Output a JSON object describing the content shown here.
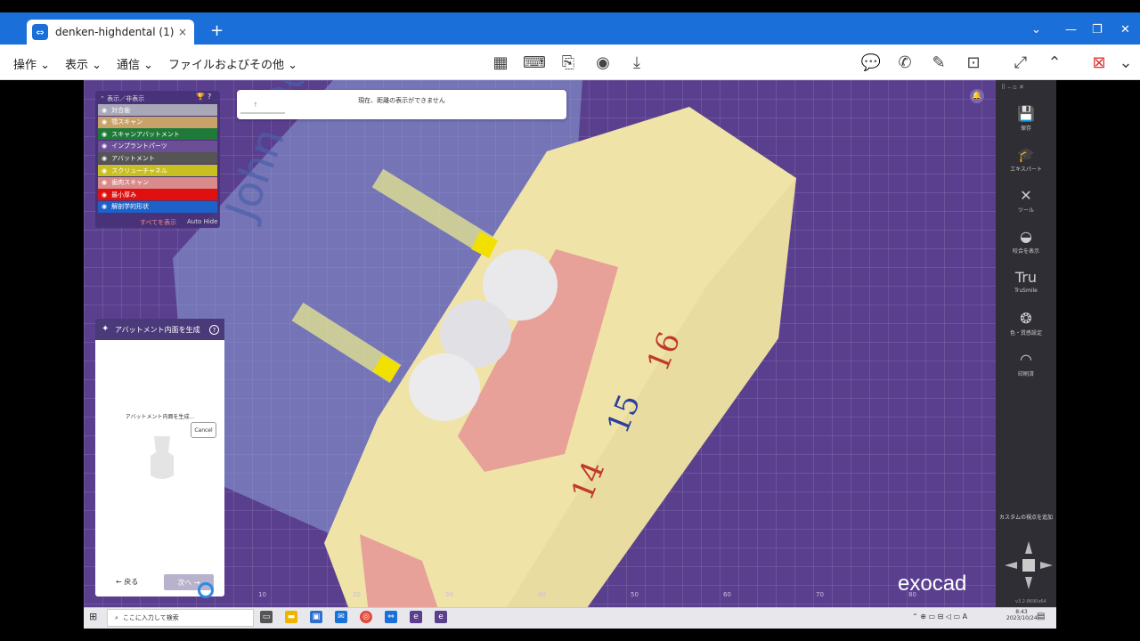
{
  "browser": {
    "tab_title": "denken-highdental (1)",
    "close_glyph": "×",
    "new_tab_glyph": "+"
  },
  "menu": {
    "items": [
      "操作",
      "表示",
      "通信",
      "ファイルおよびその他"
    ]
  },
  "layers": {
    "header": "表示／非表示",
    "items": [
      {
        "label": "対合歯",
        "color": "#a8a8b8"
      },
      {
        "label": "顎スキャン",
        "color": "#c9a26a"
      },
      {
        "label": "スキャンアバットメント",
        "color": "#1f7a3a"
      },
      {
        "label": "インプラントパーツ",
        "color": "#6b4e96"
      },
      {
        "label": "アバットメント",
        "color": "#555555"
      },
      {
        "label": "スクリューチャネル",
        "color": "#c8c020"
      },
      {
        "label": "歯肉スキャン",
        "color": "#d98a8a"
      },
      {
        "label": "最小厚み",
        "color": "#e01010"
      },
      {
        "label": "解剖学的形状",
        "color": "#1d62c8"
      }
    ],
    "show_all": "すべてを表示",
    "auto_hide": "Auto Hide"
  },
  "toast": {
    "message": "現在、距離の表示ができません"
  },
  "wizard": {
    "title": "アバットメント内面を生成",
    "progress_message": "アバットメント内面を生成...",
    "cancel_label": "Cancel",
    "back_label": "戻る",
    "next_label": "次へ"
  },
  "sidebar": {
    "items": [
      {
        "icon": "save-icon",
        "label": "保存"
      },
      {
        "icon": "expert-icon",
        "label": "エキスパート"
      },
      {
        "icon": "tools-icon",
        "label": "ツール"
      },
      {
        "icon": "tooth-icon",
        "label": "咬合を表示"
      },
      {
        "icon": "trusmile-icon",
        "label": "TruSmile"
      },
      {
        "icon": "color-icon",
        "label": "色・質感設定"
      },
      {
        "icon": "crown-icon",
        "label": "印刷済"
      }
    ],
    "custom_view_label": "カスタムの視点を追加",
    "version": "v3.2-8690x64"
  },
  "viewport": {
    "brand": "exocad",
    "model_numbers": [
      "14",
      "15",
      "16"
    ],
    "model_name": "John Doe",
    "axis_ticks": [
      "10",
      "20",
      "30",
      "40",
      "50",
      "60",
      "70",
      "80"
    ]
  },
  "taskbar": {
    "search_placeholder": "ここに入力して検索",
    "time": "8:43",
    "date": "2023/10/24"
  },
  "colors": {
    "chrome_blue": "#1a6fd8",
    "viewport_purple": "#5a3f8e",
    "gingiva_pink": "#e8a198",
    "stone_yellow": "#efe3a8"
  }
}
